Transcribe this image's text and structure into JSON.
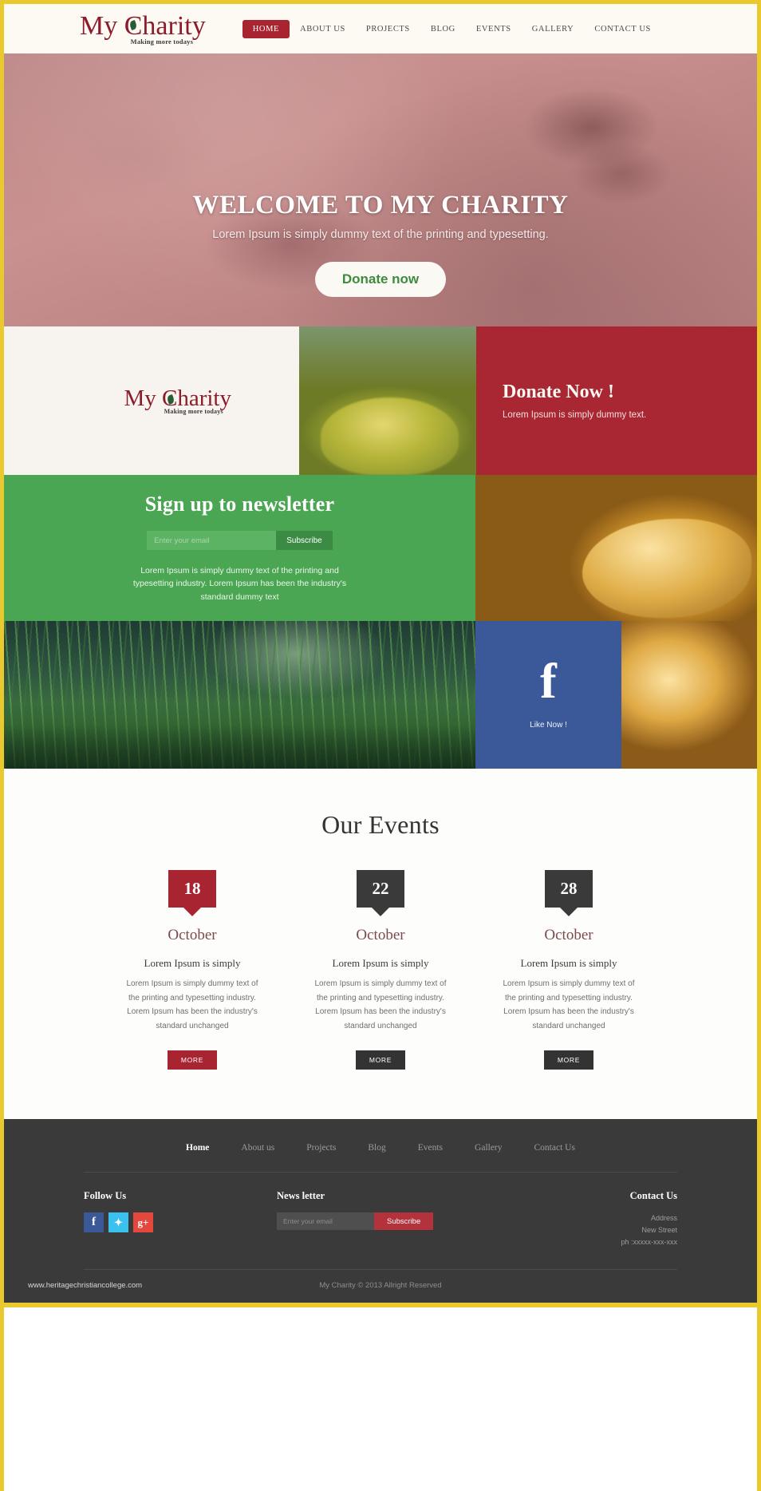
{
  "brand": {
    "name_part1": "My ",
    "name_c": "C",
    "name_rest": "harity",
    "tagline": "Making more todays",
    "accent_red": "#a82430",
    "accent_green": "#4ba653",
    "accent_yellow": "#e9c92e",
    "leaf_icon": "leaf-icon"
  },
  "nav": {
    "items": [
      {
        "label": "HOME",
        "active": true
      },
      {
        "label": "ABOUT US",
        "active": false
      },
      {
        "label": "PROJECTS",
        "active": false
      },
      {
        "label": "BLOG",
        "active": false
      },
      {
        "label": "EVENTS",
        "active": false
      },
      {
        "label": "GALLERY",
        "active": false
      },
      {
        "label": "CONTACT US",
        "active": false
      }
    ]
  },
  "hero": {
    "title": "WELCOME TO MY CHARITY",
    "subtitle": "Lorem Ipsum is simply dummy text of the printing and typesetting.",
    "cta_label": "Donate now"
  },
  "promo": {
    "donate_title": "Donate Now !",
    "donate_text": "Lorem Ipsum is simply dummy text."
  },
  "newsletter": {
    "heading": "Sign up to newsletter",
    "email_placeholder": "Enter your email",
    "email_value": "",
    "subscribe_label": "Subscribe",
    "description": "Lorem Ipsum is simply dummy text of the printing and typesetting industry. Lorem Ipsum has been the industry's standard dummy text"
  },
  "facebook": {
    "glyph": "f",
    "icon_name": "facebook-icon",
    "label": "Like Now !"
  },
  "events": {
    "heading": "Our Events",
    "cards": [
      {
        "day": "18",
        "month": "October",
        "title": "Lorem Ipsum is simply",
        "text": "Lorem Ipsum is simply dummy text of the printing and typesetting industry. Lorem Ipsum has been the industry's standard unchanged",
        "more_label": "MORE",
        "theme": "red"
      },
      {
        "day": "22",
        "month": "October",
        "title": "Lorem Ipsum is simply",
        "text": "Lorem Ipsum is simply dummy text of the printing and typesetting industry. Lorem Ipsum has been the industry's standard unchanged",
        "more_label": "MORE",
        "theme": "dark"
      },
      {
        "day": "28",
        "month": "October",
        "title": "Lorem Ipsum is simply",
        "text": "Lorem Ipsum is simply dummy text of the printing and typesetting industry. Lorem Ipsum has been the industry's standard unchanged",
        "more_label": "MORE",
        "theme": "dark"
      }
    ]
  },
  "footer": {
    "nav": [
      {
        "label": "Home",
        "active": true
      },
      {
        "label": "About us",
        "active": false
      },
      {
        "label": "Projects",
        "active": false
      },
      {
        "label": "Blog",
        "active": false
      },
      {
        "label": "Events",
        "active": false
      },
      {
        "label": "Gallery",
        "active": false
      },
      {
        "label": "Contact Us",
        "active": false
      }
    ],
    "follow_heading": "Follow Us",
    "social": [
      {
        "icon": "facebook-icon",
        "glyph": "f",
        "class": "fb"
      },
      {
        "icon": "twitter-icon",
        "glyph": "✦",
        "class": "tw"
      },
      {
        "icon": "google-plus-icon",
        "glyph": "g+",
        "class": "gp"
      }
    ],
    "news_heading": "News letter",
    "news_placeholder": "Enter your email",
    "news_value": "",
    "news_button": "Subscribe",
    "contact_heading": "Contact Us",
    "contact_lines": [
      "Address",
      "New Street",
      "ph :xxxxx-xxx-xxx"
    ],
    "site_url": "www.heritagechristiancollege.com",
    "copyright": "My Charity © 2013 Allright Reserved"
  }
}
